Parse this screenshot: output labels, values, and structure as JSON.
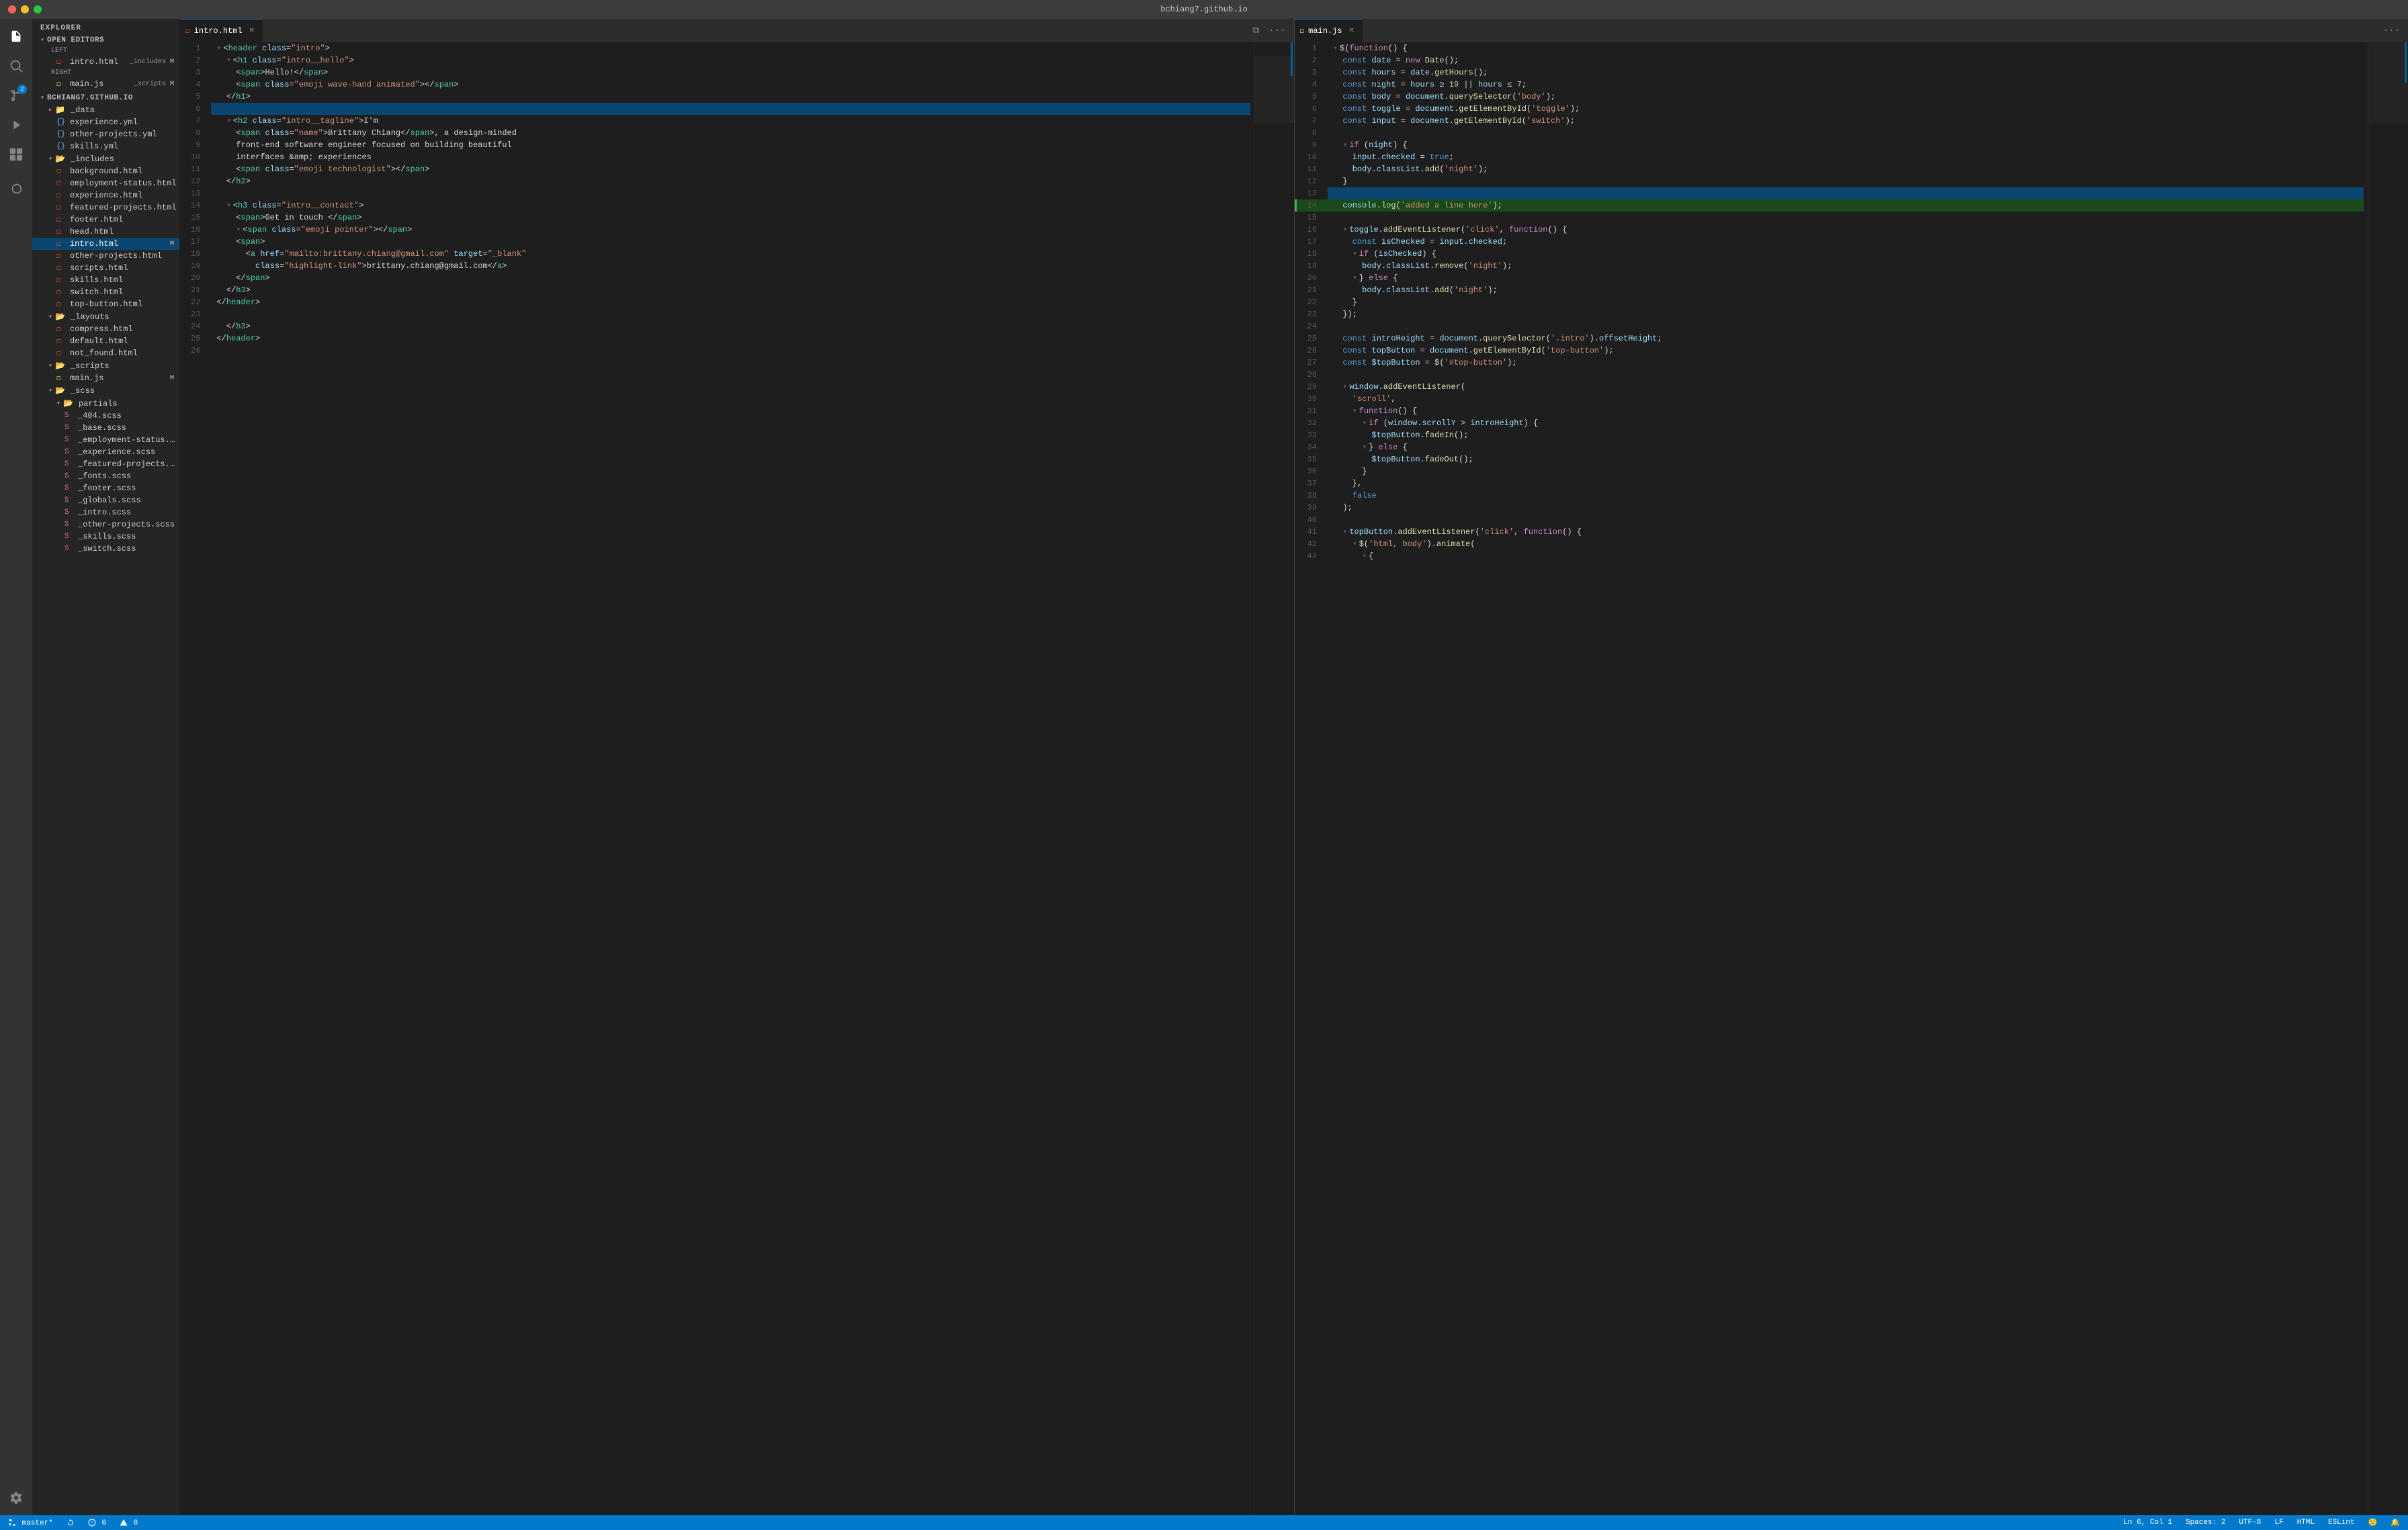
{
  "titleBar": {
    "title": "bchiang7.github.io"
  },
  "activityBar": {
    "icons": [
      {
        "name": "files-icon",
        "symbol": "⧉",
        "active": true
      },
      {
        "name": "search-icon",
        "symbol": "🔍",
        "active": false
      },
      {
        "name": "source-control-icon",
        "symbol": "⑂",
        "active": false,
        "badge": "2"
      },
      {
        "name": "run-icon",
        "symbol": "▶",
        "active": false
      },
      {
        "name": "extensions-icon",
        "symbol": "⊞",
        "active": false
      },
      {
        "name": "docker-icon",
        "symbol": "🐳",
        "active": false
      }
    ],
    "bottomIcons": [
      {
        "name": "settings-icon",
        "symbol": "⚙"
      }
    ]
  },
  "sidebar": {
    "title": "EXPLORER",
    "openEditors": {
      "label": "OPEN EDITORS",
      "left": {
        "label": "LEFT",
        "files": [
          {
            "name": "intro.html",
            "badge": "_includes",
            "badgeLetter": "M",
            "active": false,
            "icon": "html"
          }
        ]
      },
      "right": {
        "label": "RIGHT",
        "files": [
          {
            "name": "main.js",
            "badge": "_scripts",
            "badgeLetter": "M",
            "active": false,
            "icon": "js"
          }
        ]
      }
    },
    "project": {
      "label": "BCHIANG7.GITHUB.IO",
      "folders": [
        {
          "name": "_data",
          "indent": 1,
          "open": false,
          "files": [
            {
              "name": "experience.yml",
              "indent": 2,
              "icon": "yml"
            },
            {
              "name": "other-projects.yml",
              "indent": 2,
              "icon": "yml"
            },
            {
              "name": "skills.yml",
              "indent": 2,
              "icon": "yml"
            }
          ]
        },
        {
          "name": "_includes",
          "indent": 1,
          "open": true,
          "files": [
            {
              "name": "background.html",
              "indent": 2,
              "icon": "html"
            },
            {
              "name": "employment-status.html",
              "indent": 2,
              "icon": "html"
            },
            {
              "name": "experience.html",
              "indent": 2,
              "icon": "html"
            },
            {
              "name": "featured-projects.html",
              "indent": 2,
              "icon": "html"
            },
            {
              "name": "footer.html",
              "indent": 2,
              "icon": "html"
            },
            {
              "name": "head.html",
              "indent": 2,
              "icon": "html"
            },
            {
              "name": "intro.html",
              "indent": 2,
              "icon": "html",
              "active": true,
              "badgeLetter": "M"
            },
            {
              "name": "other-projects.html",
              "indent": 2,
              "icon": "html"
            },
            {
              "name": "scripts.html",
              "indent": 2,
              "icon": "html"
            },
            {
              "name": "skills.html",
              "indent": 2,
              "icon": "html"
            },
            {
              "name": "switch.html",
              "indent": 2,
              "icon": "html"
            },
            {
              "name": "top-button.html",
              "indent": 2,
              "icon": "html"
            }
          ]
        },
        {
          "name": "_layouts",
          "indent": 1,
          "open": true,
          "files": [
            {
              "name": "compress.html",
              "indent": 2,
              "icon": "html"
            },
            {
              "name": "default.html",
              "indent": 2,
              "icon": "html"
            },
            {
              "name": "not_found.html",
              "indent": 2,
              "icon": "html"
            }
          ]
        },
        {
          "name": "_scripts",
          "indent": 1,
          "open": true,
          "files": [
            {
              "name": "main.js",
              "indent": 2,
              "icon": "js",
              "badgeLetter": "M"
            }
          ]
        },
        {
          "name": "_scss",
          "indent": 1,
          "open": true,
          "files": []
        },
        {
          "name": "partials",
          "indent": 2,
          "open": true,
          "files": [
            {
              "name": "_404.scss",
              "indent": 3,
              "icon": "scss"
            },
            {
              "name": "_base.scss",
              "indent": 3,
              "icon": "scss"
            },
            {
              "name": "_employment-status.sc...",
              "indent": 3,
              "icon": "scss"
            },
            {
              "name": "_experience.scss",
              "indent": 3,
              "icon": "scss"
            },
            {
              "name": "_featured-projects.scss",
              "indent": 3,
              "icon": "scss"
            },
            {
              "name": "_fonts.scss",
              "indent": 3,
              "icon": "scss"
            },
            {
              "name": "_footer.scss",
              "indent": 3,
              "icon": "scss"
            },
            {
              "name": "_globals.scss",
              "indent": 3,
              "icon": "scss"
            },
            {
              "name": "_intro.scss",
              "indent": 3,
              "icon": "scss"
            },
            {
              "name": "_other-projects.scss",
              "indent": 3,
              "icon": "scss"
            },
            {
              "name": "_skills.scss",
              "indent": 3,
              "icon": "scss"
            },
            {
              "name": "_switch.scss",
              "indent": 3,
              "icon": "scss"
            }
          ]
        }
      ]
    }
  },
  "editorLeft": {
    "tab": {
      "name": "intro.html",
      "icon": "html",
      "modified": false
    },
    "lines": [
      {
        "num": 1,
        "content": "<header class=\"intro\">",
        "type": "html"
      },
      {
        "num": 2,
        "content": "  <h1 class=\"intro__hello\">",
        "type": "html"
      },
      {
        "num": 3,
        "content": "    <span>Hello!</span>",
        "type": "html"
      },
      {
        "num": 4,
        "content": "    <span class=\"emoji wave-hand animated\"></span>",
        "type": "html"
      },
      {
        "num": 5,
        "content": "  </h1>",
        "type": "html"
      },
      {
        "num": 6,
        "content": "",
        "type": "blank",
        "highlighted": true
      },
      {
        "num": 7,
        "content": "  <h2 class=\"intro__tagline\">I'm",
        "type": "html"
      },
      {
        "num": 8,
        "content": "    <span class=\"name\">Brittany Chiang</span>, a design-minded",
        "type": "html"
      },
      {
        "num": 9,
        "content": "    front-end software engineer focused on building beautiful",
        "type": "html"
      },
      {
        "num": 10,
        "content": "    interfaces &amp; experiences",
        "type": "html"
      },
      {
        "num": 11,
        "content": "    <span class=\"emoji technologist\"></span>",
        "type": "html"
      },
      {
        "num": 12,
        "content": "  </h2>",
        "type": "html"
      },
      {
        "num": 13,
        "content": "",
        "type": "blank"
      },
      {
        "num": 14,
        "content": "  <h3 class=\"intro__contact\">",
        "type": "html"
      },
      {
        "num": 15,
        "content": "    <span>Get in touch </span>",
        "type": "html"
      },
      {
        "num": 16,
        "content": "    <span class=\"emoji pointer\"></span>",
        "type": "html"
      },
      {
        "num": 17,
        "content": "    <span>",
        "type": "html"
      },
      {
        "num": 18,
        "content": "      <a href=\"mailto:brittany.chiang@gmail.com\" target=\"_blank\"",
        "type": "html"
      },
      {
        "num": 19,
        "content": "        class=\"highlight-link\">brittany.chiang@gmail.com</a>",
        "type": "html"
      },
      {
        "num": 20,
        "content": "    </span>",
        "type": "html"
      },
      {
        "num": 21,
        "content": "  </h3>",
        "type": "html"
      },
      {
        "num": 22,
        "content": "</header>",
        "type": "html"
      },
      {
        "num": 23,
        "content": "",
        "type": "blank"
      },
      {
        "num": 24,
        "content": "  </h3>",
        "type": "html"
      },
      {
        "num": 25,
        "content": "</header>",
        "type": "html"
      },
      {
        "num": 26,
        "content": "",
        "type": "blank"
      }
    ]
  },
  "editorRight": {
    "tab": {
      "name": "main.js",
      "icon": "js",
      "modified": false
    },
    "lines": [
      {
        "num": 1,
        "content": "$(function() {",
        "type": "js"
      },
      {
        "num": 2,
        "content": "  const date = new Date();",
        "type": "js"
      },
      {
        "num": 3,
        "content": "  const hours = date.getHours();",
        "type": "js"
      },
      {
        "num": 4,
        "content": "  const night = hours >= 19 || hours <= 7;",
        "type": "js"
      },
      {
        "num": 5,
        "content": "  const body = document.querySelector('body');",
        "type": "js"
      },
      {
        "num": 6,
        "content": "  const toggle = document.getElementById('toggle');",
        "type": "js"
      },
      {
        "num": 7,
        "content": "  const input = document.getElementById('switch');",
        "type": "js"
      },
      {
        "num": 8,
        "content": "",
        "type": "blank"
      },
      {
        "num": 9,
        "content": "  if (night) {",
        "type": "js"
      },
      {
        "num": 10,
        "content": "    input.checked = true;",
        "type": "js"
      },
      {
        "num": 11,
        "content": "    body.classList.add('night');",
        "type": "js"
      },
      {
        "num": 12,
        "content": "  }",
        "type": "js"
      },
      {
        "num": 13,
        "content": "",
        "type": "blank",
        "highlighted": true
      },
      {
        "num": 14,
        "content": "  console.log('added a line here');",
        "type": "js",
        "diffAdded": true
      },
      {
        "num": 15,
        "content": "",
        "type": "blank"
      },
      {
        "num": 16,
        "content": "  toggle.addEventListener('click', function() {",
        "type": "js"
      },
      {
        "num": 17,
        "content": "    const isChecked = input.checked;",
        "type": "js"
      },
      {
        "num": 18,
        "content": "    if (isChecked) {",
        "type": "js"
      },
      {
        "num": 19,
        "content": "      body.classList.remove('night');",
        "type": "js"
      },
      {
        "num": 20,
        "content": "    } else {",
        "type": "js"
      },
      {
        "num": 21,
        "content": "      body.classList.add('night');",
        "type": "js"
      },
      {
        "num": 22,
        "content": "    }",
        "type": "js"
      },
      {
        "num": 23,
        "content": "  });",
        "type": "js"
      },
      {
        "num": 24,
        "content": "",
        "type": "blank"
      },
      {
        "num": 25,
        "content": "  const introHeight = document.querySelector('.intro').offsetHeight;",
        "type": "js"
      },
      {
        "num": 26,
        "content": "  const topButton = document.getElementById('top-button');",
        "type": "js"
      },
      {
        "num": 27,
        "content": "  const $topButton = $('#top-button');",
        "type": "js"
      },
      {
        "num": 28,
        "content": "",
        "type": "blank"
      },
      {
        "num": 29,
        "content": "  window.addEventListener(",
        "type": "js"
      },
      {
        "num": 30,
        "content": "    'scroll',",
        "type": "js"
      },
      {
        "num": 31,
        "content": "    function() {",
        "type": "js"
      },
      {
        "num": 32,
        "content": "      if (window.scrollY > introHeight) {",
        "type": "js"
      },
      {
        "num": 33,
        "content": "        $topButton.fadeIn();",
        "type": "js"
      },
      {
        "num": 34,
        "content": "      } else {",
        "type": "js"
      },
      {
        "num": 35,
        "content": "        $topButton.fadeOut();",
        "type": "js"
      },
      {
        "num": 36,
        "content": "      }",
        "type": "js"
      },
      {
        "num": 37,
        "content": "    },",
        "type": "js"
      },
      {
        "num": 38,
        "content": "    false",
        "type": "js"
      },
      {
        "num": 39,
        "content": "  );",
        "type": "js"
      },
      {
        "num": 40,
        "content": "",
        "type": "blank"
      },
      {
        "num": 41,
        "content": "  topButton.addEventListener('click', function() {",
        "type": "js"
      },
      {
        "num": 42,
        "content": "    $('html, body').animate(",
        "type": "js"
      },
      {
        "num": 43,
        "content": "      {",
        "type": "js"
      }
    ]
  },
  "statusBar": {
    "branch": "master*",
    "errors": "0",
    "warnings": "0",
    "position": "Ln 6, Col 1",
    "spaces": "Spaces: 2",
    "encoding": "UTF-8",
    "lineEnding": "LF",
    "language": "HTML",
    "linter": "ESLint",
    "leftIcons": [
      "sync-icon",
      "error-icon",
      "warning-icon"
    ]
  }
}
